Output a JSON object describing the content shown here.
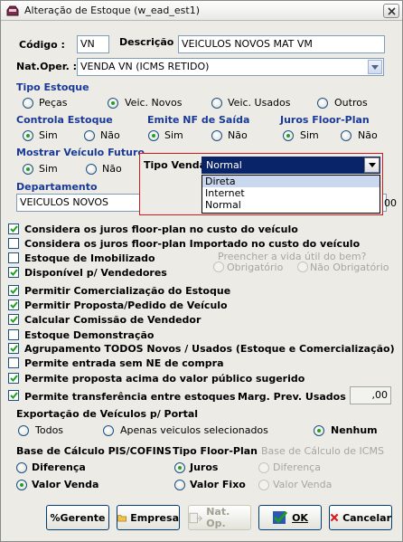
{
  "window": {
    "title": "Alteração de Estoque (w_ead_est1)"
  },
  "header": {
    "codigo_label": "Código :",
    "codigo_value": "VN",
    "descricao_label": "Descrição :",
    "descricao_value": "VEICULOS NOVOS MAT  VM",
    "natoper_label": "Nat.Oper. :",
    "natoper_value": "VENDA VN (ICMS RETIDO)"
  },
  "tipo_estoque": {
    "label": "Tipo Estoque",
    "options": [
      "Peças",
      "Veic. Novos",
      "Veic. Usados",
      "Outros"
    ],
    "selected": "Veic. Novos"
  },
  "controla_estoque": {
    "label": "Controla Estoque",
    "options": [
      "Sim",
      "Não"
    ],
    "selected": "Sim"
  },
  "emite_nf": {
    "label": "Emite NF de Saída",
    "options": [
      "Sim",
      "Não"
    ],
    "selected": "Sim"
  },
  "juros_floor": {
    "label": "Juros Floor-Plan",
    "options": [
      "Sim",
      "Não"
    ],
    "selected": "Sim"
  },
  "mostrar_veiculo": {
    "label": "Mostrar Veículo Futuro",
    "options": [
      "Sim",
      "Não"
    ],
    "selected": "Sim"
  },
  "tipo_venda": {
    "label": "Tipo Venda:",
    "value": "Normal",
    "options": [
      "Direta",
      "Internet",
      "Normal"
    ],
    "highlighted": "Direta"
  },
  "departamento": {
    "label": "Departamento",
    "value": "VEICULOS NOVOS",
    "suffix_value": "00"
  },
  "vida_util": {
    "question": "Preencher a vida útil do bem?",
    "options": [
      "Obrigatório",
      "Não Obrigatório"
    ]
  },
  "checkboxes": [
    {
      "label": "Considera os juros floor-plan no custo do veículo",
      "checked": true
    },
    {
      "label": "Considera os juros floor-plan Importado no custo do veículo",
      "checked": false
    },
    {
      "label": "Estoque de Imobilizado",
      "checked": false
    },
    {
      "label": "Disponível p/ Vendedores",
      "checked": true
    },
    {
      "label": "Permitir Comercialização do Estoque",
      "checked": true
    },
    {
      "label": "Permitir Proposta/Pedido de Veículo",
      "checked": true
    },
    {
      "label": "Calcular Comissão de Vendedor",
      "checked": true
    },
    {
      "label": "Estoque Demonstração",
      "checked": false
    },
    {
      "label": "Agrupamento TODOS Novos / Usados (Estoque e Comercialização)",
      "checked": true
    },
    {
      "label": "Permite entrada sem NE de compra",
      "checked": false
    },
    {
      "label": "Permite proposta acima do valor público sugerido",
      "checked": true
    },
    {
      "label": "Permite transferência entre estoques",
      "checked": true
    }
  ],
  "marg_prev": {
    "label": "Marg. Prev. Usados (%):",
    "value": ",00"
  },
  "exportacao": {
    "label": "Exportação de Veículos p/ Portal",
    "options": [
      "Todos",
      "Apenas veiculos selecionados",
      "Nenhum"
    ],
    "selected": "Nenhum"
  },
  "base_pis": {
    "label": "Base de Cálculo PIS/COFINS",
    "options": [
      "Diferença",
      "Valor Venda"
    ],
    "selected": "Valor Venda"
  },
  "tipo_floor": {
    "label": "Tipo Floor-Plan",
    "options": [
      "Juros",
      "Valor Fixo"
    ],
    "selected": "Juros"
  },
  "base_icms": {
    "label": "Base de Cálculo de ICMS",
    "options": [
      "Diferença",
      "Valor Venda"
    ],
    "selected": ""
  },
  "buttons": {
    "gerente": "%Gerente",
    "empresa": "Empresa",
    "natop": "Nat. Op.",
    "ok": "OK",
    "cancelar": "Cancelar"
  },
  "colors": {
    "accent_red": "#d6191f",
    "label_blue": "#1a3a96",
    "radio_green": "#21a121"
  }
}
